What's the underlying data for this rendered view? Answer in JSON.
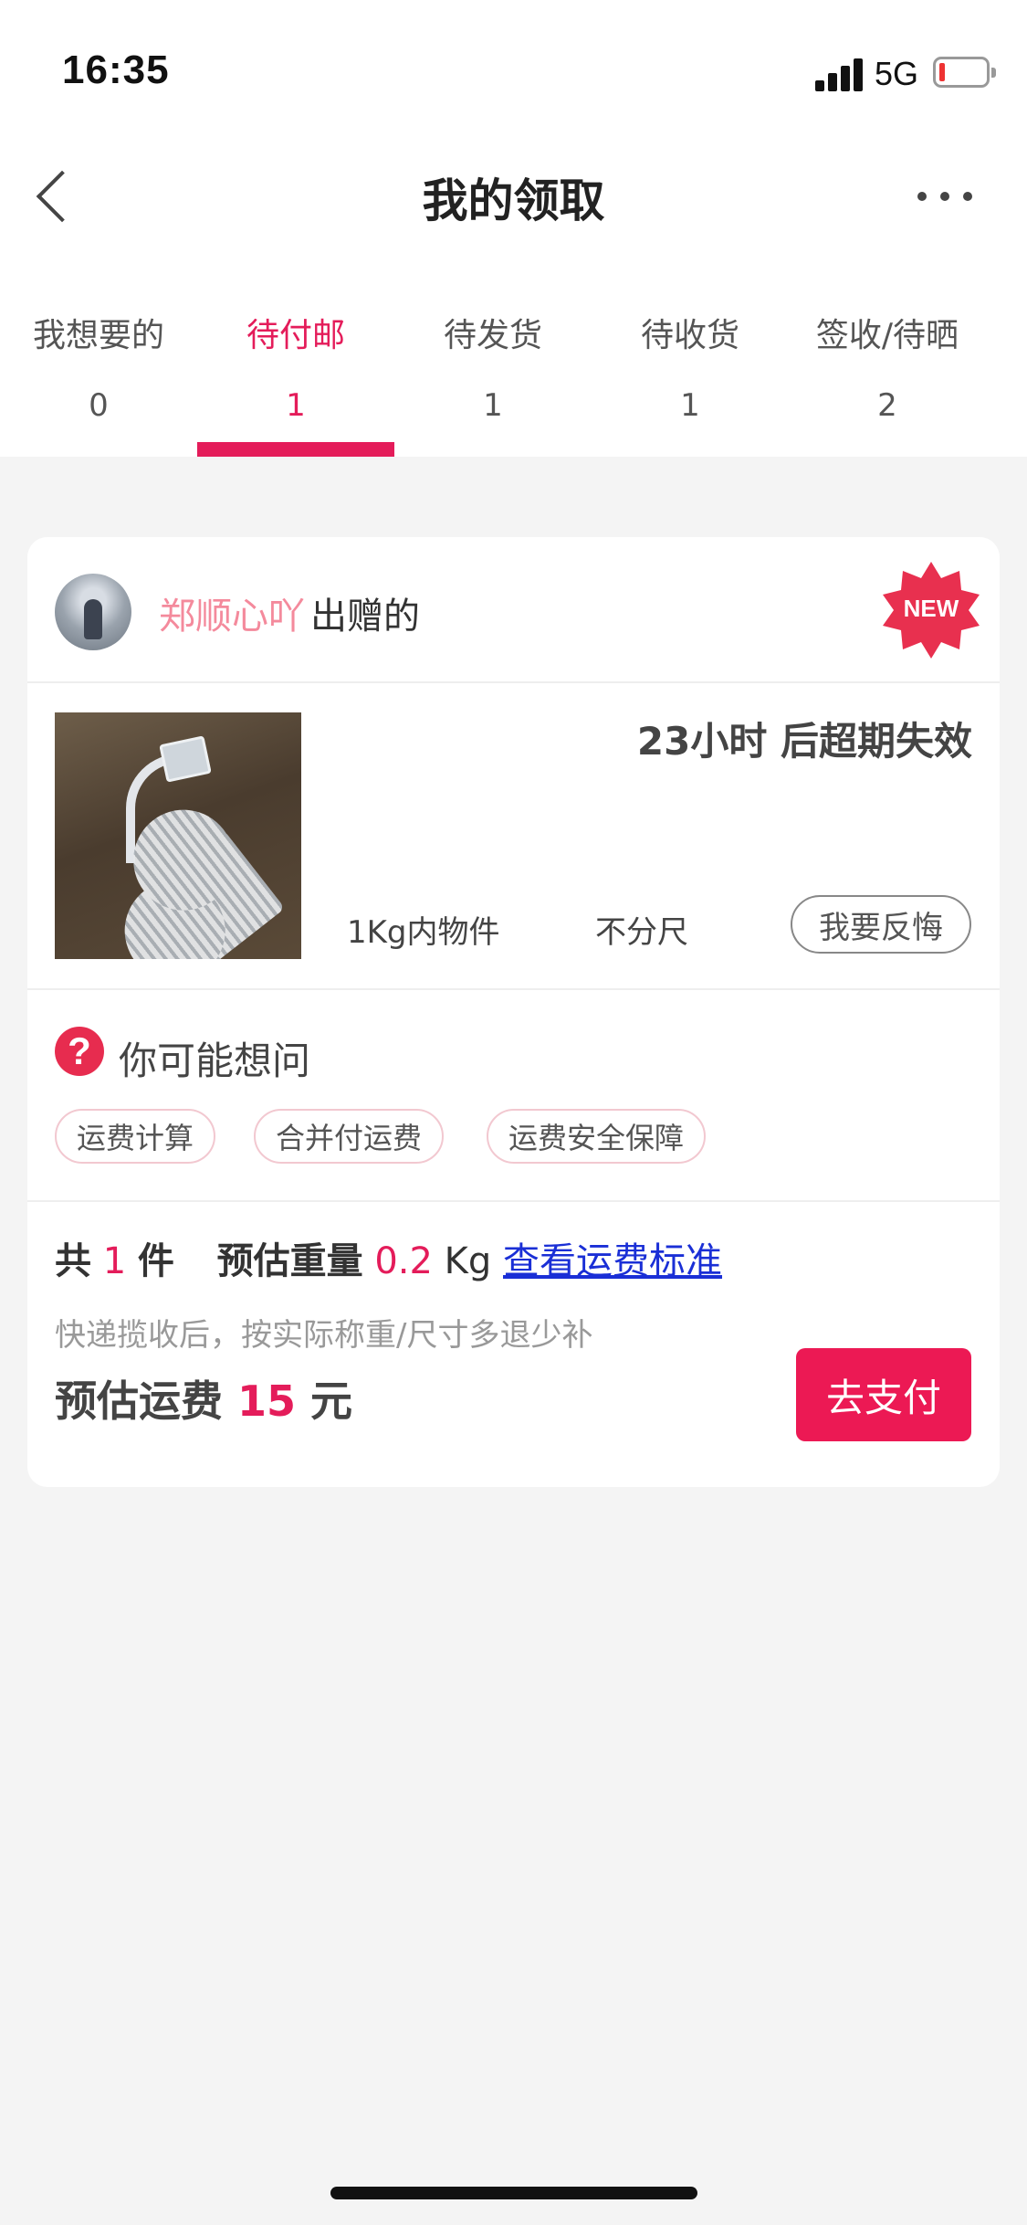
{
  "status_bar": {
    "time": "16:35",
    "network": "5G",
    "battery_level": 0.1
  },
  "nav": {
    "title": "我的领取",
    "back_icon": "chevron-left-icon",
    "more_icon": "more-horizontal-icon"
  },
  "tabs": [
    {
      "label": "我想要的",
      "count": "0",
      "active": false
    },
    {
      "label": "待付邮",
      "count": "1",
      "active": true
    },
    {
      "label": "待发货",
      "count": "1",
      "active": false
    },
    {
      "label": "待收货",
      "count": "1",
      "active": false
    },
    {
      "label": "签收/待晒",
      "count": "2",
      "active": false
    }
  ],
  "order": {
    "giver_name": "郑顺心吖",
    "giver_suffix": "出赠的",
    "badge": "NEW",
    "expire_text": "23小时 后超期失效",
    "weight_spec": "1Kg内物件",
    "size_spec": "不分尺",
    "regret_label": "我要反悔"
  },
  "faq": {
    "icon": "question-icon",
    "title": "你可能想问",
    "chips": [
      "运费计算",
      "合并付运费",
      "运费安全保障"
    ]
  },
  "summary": {
    "total_prefix": "共",
    "count": "1",
    "count_unit": "件",
    "weight_label": "预估重量",
    "weight_value": "0.2",
    "weight_unit": "Kg",
    "link": "查看运费标准",
    "note": "快递揽收后，按实际称重/尺寸多退少补",
    "fee_label": "预估运费",
    "fee_value": "15",
    "fee_unit": "元",
    "pay_label": "去支付"
  },
  "colors": {
    "accent": "#e41c5a",
    "pay_button": "#ec1954",
    "link": "#1a2fd6",
    "giver_name": "#f48a9c"
  }
}
